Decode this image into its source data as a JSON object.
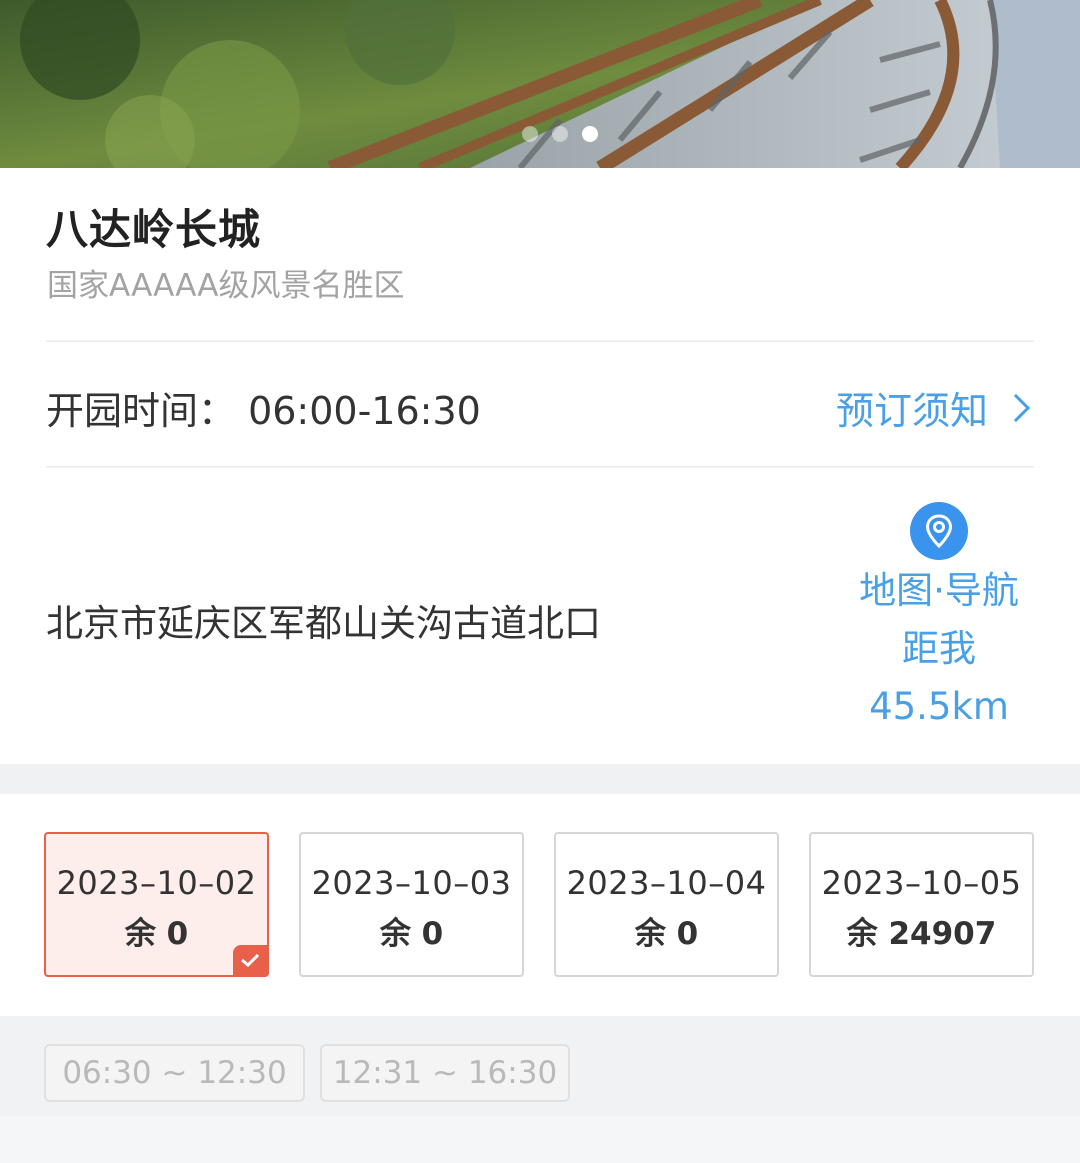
{
  "banner": {
    "pager": {
      "count": 3,
      "active": 3
    }
  },
  "attraction": {
    "name": "八达岭长城",
    "rating": "国家AAAAA级风景名胜区",
    "hours": "开园时间：  06:00-16:30",
    "notice_label": "预订须知",
    "address": "北京市延庆区军都山关沟古道北口",
    "map_nav_label": "地图·导航",
    "distance_label": "距我",
    "distance_value": "45.5km"
  },
  "dates": [
    {
      "date": "2023–10–02",
      "remain": "余 0",
      "selected": true
    },
    {
      "date": "2023–10–03",
      "remain": "余 0",
      "selected": false
    },
    {
      "date": "2023–10–04",
      "remain": "余 0",
      "selected": false
    },
    {
      "date": "2023–10–05",
      "remain": "余 24907",
      "selected": false
    }
  ],
  "time_slots": [
    {
      "label": "06:30 ~ 12:30",
      "disabled": true
    },
    {
      "label": "12:31 ~ 16:30",
      "disabled": true
    }
  ],
  "colors": {
    "accent_blue": "#4aa0e6",
    "pin_blue": "#3a94ee",
    "selected_red": "#e8604a",
    "selected_bg": "#fdeeec"
  },
  "icons": {
    "location": "location-pin-icon",
    "chevron": "chevron-right-icon",
    "check": "check-icon"
  }
}
